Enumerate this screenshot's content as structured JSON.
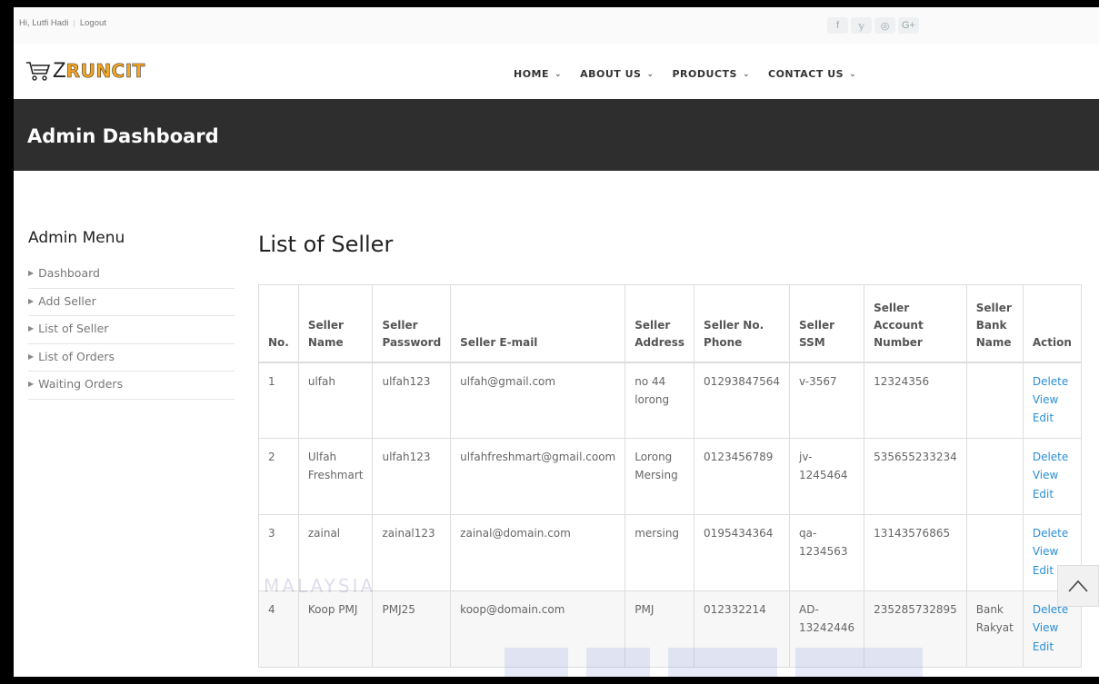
{
  "topbar": {
    "greeting": "Hi, Lutfi Hadi",
    "logout": "Logout",
    "social": [
      {
        "icon": "facebook-icon",
        "glyph": "f"
      },
      {
        "icon": "twitter-icon",
        "glyph": "𝕪"
      },
      {
        "icon": "instagram-icon",
        "glyph": "◎"
      },
      {
        "icon": "google-plus-icon",
        "glyph": "G+"
      }
    ]
  },
  "header": {
    "logo_prefix": "Z",
    "logo_text": "RUNCIT",
    "nav": [
      {
        "label": "HOME"
      },
      {
        "label": "ABOUT US"
      },
      {
        "label": "PRODUCTS"
      },
      {
        "label": "CONTACT US"
      }
    ]
  },
  "banner": {
    "title": "Admin Dashboard"
  },
  "sidebar": {
    "title": "Admin Menu",
    "items": [
      {
        "label": "Dashboard"
      },
      {
        "label": "Add Seller"
      },
      {
        "label": "List of Seller"
      },
      {
        "label": "List of Orders"
      },
      {
        "label": "Waiting Orders"
      }
    ]
  },
  "main": {
    "title": "List of Seller",
    "columns": [
      "No.",
      "Seller Name",
      "Seller Password",
      "Seller E-mail",
      "Seller Address",
      "Seller No. Phone",
      "Seller SSM",
      "Seller Account Number",
      "Seller Bank Name",
      "Action"
    ],
    "rows": [
      {
        "no": "1",
        "name": "ulfah",
        "password": "ulfah123",
        "email": "ulfah@gmail.com",
        "address": "no 44 lorong",
        "phone": "01293847564",
        "ssm": "v-3567",
        "account": "12324356",
        "bank": ""
      },
      {
        "no": "2",
        "name": "Ulfah Freshmart",
        "password": "ulfah123",
        "email": "ulfahfreshmart@gmail.coom",
        "address": "Lorong Mersing",
        "phone": "0123456789",
        "ssm": "jv-1245464",
        "account": "535655233234",
        "bank": ""
      },
      {
        "no": "3",
        "name": "zainal",
        "password": "zainal123",
        "email": "zainal@domain.com",
        "address": "mersing",
        "phone": "0195434364",
        "ssm": "qa-1234563",
        "account": "13143576865",
        "bank": ""
      },
      {
        "no": "4",
        "name": "Koop PMJ",
        "password": "PMJ25",
        "email": "koop@domain.com",
        "address": "PMJ",
        "phone": "012332214",
        "ssm": "AD-13242446",
        "account": "235285732895",
        "bank": "Bank Rakyat"
      }
    ],
    "actions": [
      "Delete",
      "View",
      "Edit"
    ]
  },
  "watermark": {
    "text": "MALAYSIA"
  }
}
